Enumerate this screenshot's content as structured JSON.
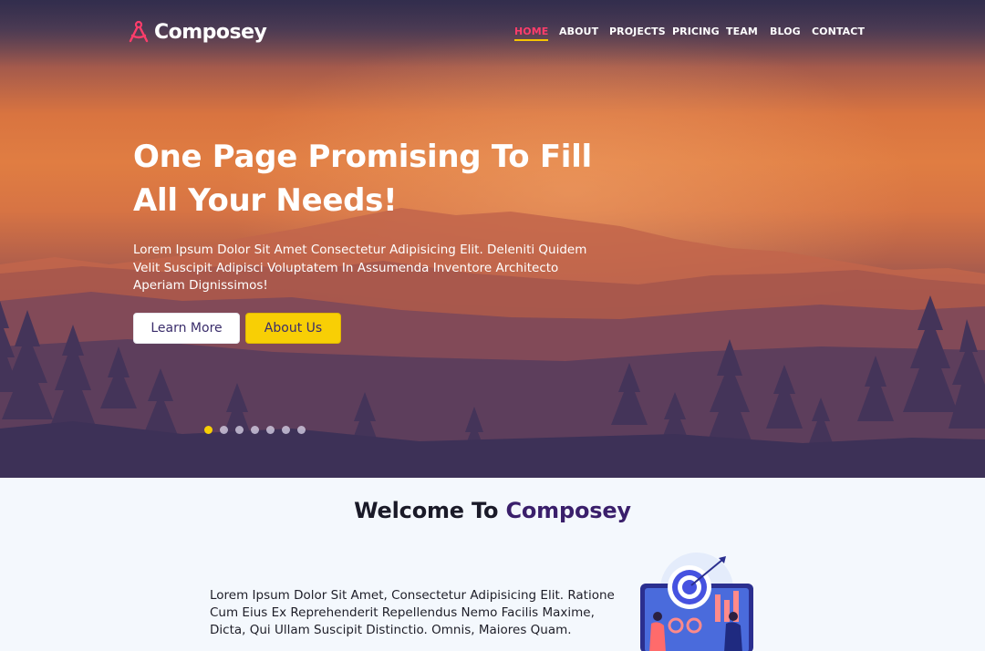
{
  "brand": {
    "name": "Composey"
  },
  "nav": {
    "items": [
      {
        "label": "HOME",
        "active": true
      },
      {
        "label": "ABOUT",
        "active": false
      },
      {
        "label": "PROJECTS",
        "active": false
      },
      {
        "label": "PRICING",
        "active": false
      },
      {
        "label": "TEAM",
        "active": false
      },
      {
        "label": "BLOG",
        "active": false
      },
      {
        "label": "CONTACT",
        "active": false
      }
    ]
  },
  "hero": {
    "title": "One Page Promising To Fill All Your Needs!",
    "text": "Lorem Ipsum Dolor Sit Amet Consectetur Adipisicing Elit. Deleniti Quidem Velit Suscipit Adipisci Voluptatem In Assumenda Inventore Architecto Aperiam Dignissimos!",
    "learn_more": "Learn More",
    "about_us": "About Us",
    "slide_count": 7,
    "active_slide": 1
  },
  "welcome": {
    "title_prefix": "Welcome To",
    "title_brand": "Composey",
    "text": "Lorem Ipsum Dolor Sit Amet, Consectetur Adipisicing Elit. Ratione Cum Eius Ex Reprehenderit Repellendus Nemo Facilis Maxime, Dicta, Qui Ullam Suscipit Distinctio. Omnis, Maiores Quam."
  },
  "colors": {
    "accent_pink": "#ff3d6b",
    "accent_yellow": "#f8cf05",
    "brand_purple": "#3a1f6b"
  }
}
